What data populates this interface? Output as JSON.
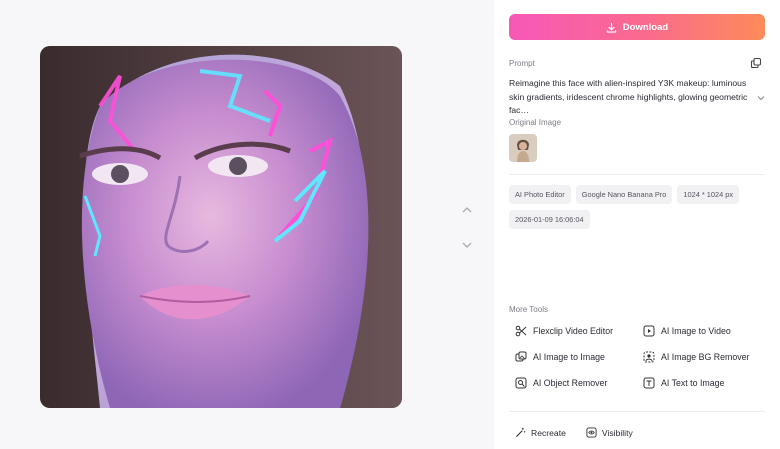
{
  "download": {
    "label": "Download",
    "icon": "download-icon"
  },
  "prompt": {
    "label": "Prompt",
    "text": "Reimagine this face with alien-inspired Y3K makeup: luminous skin gradients, iridescent chrome highlights, glowing geometric fac…"
  },
  "original_image": {
    "label": "Original Image"
  },
  "tags": [
    "AI Photo Editor",
    "Google Nano Banana Pro",
    "1024 * 1024 px",
    "2026-01-09 16:06:04"
  ],
  "more_tools": {
    "label": "More Tools",
    "items": [
      {
        "label": "Flexclip Video Editor",
        "icon": "scissors-icon"
      },
      {
        "label": "AI Image to Video",
        "icon": "image-to-video-icon"
      },
      {
        "label": "AI Image to Image",
        "icon": "image-to-image-icon"
      },
      {
        "label": "AI Image BG Remover",
        "icon": "bg-remover-icon"
      },
      {
        "label": "AI Object Remover",
        "icon": "object-remover-icon"
      },
      {
        "label": "AI Text to Image",
        "icon": "text-to-image-icon"
      }
    ]
  },
  "actions": [
    {
      "label": "Recreate",
      "icon": "magic-wand-icon"
    },
    {
      "label": "Visibility",
      "icon": "visibility-icon"
    }
  ],
  "colors": {
    "accent_start": "#f758b9",
    "accent_end": "#fd8b59",
    "tag_bg": "#f1f1f4"
  }
}
